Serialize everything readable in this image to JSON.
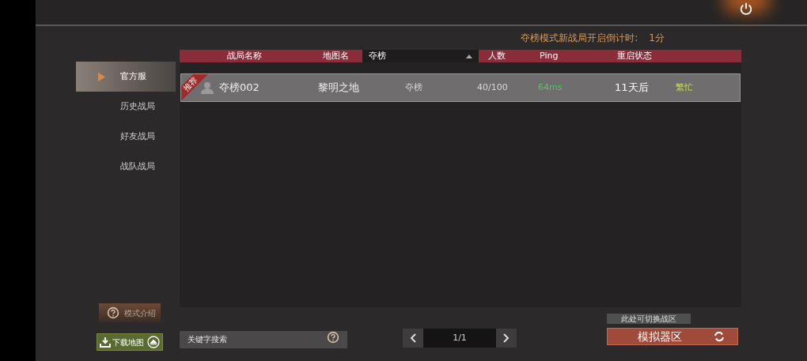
{
  "countdown": {
    "label": "夺榜模式新战局开启倒计时:",
    "value": "1分"
  },
  "sidebar": {
    "items": [
      {
        "label": "官方服",
        "selected": true
      },
      {
        "label": "历史战局",
        "selected": false
      },
      {
        "label": "好友战局",
        "selected": false
      },
      {
        "label": "战队战局",
        "selected": false
      }
    ]
  },
  "mode_help": "模式介绍",
  "download_map": "下载地图",
  "table": {
    "columns": [
      {
        "kind": "label",
        "label": "战局名称"
      },
      {
        "kind": "label",
        "label": "地图名"
      },
      {
        "kind": "filter",
        "label": "夺榜"
      },
      {
        "kind": "label",
        "label": "人数"
      },
      {
        "kind": "label",
        "label": "Ping"
      },
      {
        "kind": "label",
        "label": "重启状态"
      }
    ],
    "rows": [
      {
        "badge": "推荐",
        "name": "夺榜002",
        "map": "黎明之地",
        "mode": "夺榜",
        "players": "40/100",
        "ping": "64ms",
        "restart": "11天后",
        "status": "繁忙",
        "selected": true
      }
    ]
  },
  "search": {
    "placeholder": "关键字搜索"
  },
  "pagination": {
    "page": "1/1"
  },
  "region": {
    "tooltip": "此处可切换战区",
    "button": "模拟器区"
  }
}
